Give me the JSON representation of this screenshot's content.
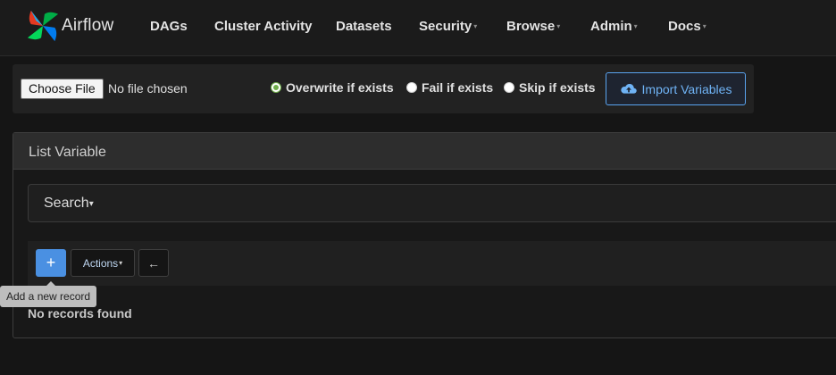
{
  "navbar": {
    "brand": "Airflow",
    "items": [
      {
        "label": "DAGs",
        "dropdown": false
      },
      {
        "label": "Cluster Activity",
        "dropdown": false
      },
      {
        "label": "Datasets",
        "dropdown": false
      },
      {
        "label": "Security",
        "dropdown": true
      },
      {
        "label": "Browse",
        "dropdown": true
      },
      {
        "label": "Admin",
        "dropdown": true
      },
      {
        "label": "Docs",
        "dropdown": true
      }
    ]
  },
  "import": {
    "file_button": "Choose File",
    "file_status": "No file chosen",
    "options": [
      {
        "label": "Overwrite if exists",
        "checked": true
      },
      {
        "label": "Fail if exists",
        "checked": false
      },
      {
        "label": "Skip if exists",
        "checked": false
      }
    ],
    "submit_label": "Import Variables"
  },
  "panel": {
    "title": "List Variable",
    "search_label": "Search",
    "add_symbol": "+",
    "actions_label": "Actions",
    "back_symbol": "←",
    "empty_message": "No records found"
  },
  "tooltip": {
    "text": "Add a new record"
  },
  "colors": {
    "accent": "#4a90e2",
    "import_border": "#5aa4ef",
    "radio_checked": "#6fae4a"
  },
  "icons": [
    "airflow-logo-icon",
    "caret-down-icon",
    "cloud-upload-icon",
    "plus-icon",
    "arrow-left-icon"
  ]
}
